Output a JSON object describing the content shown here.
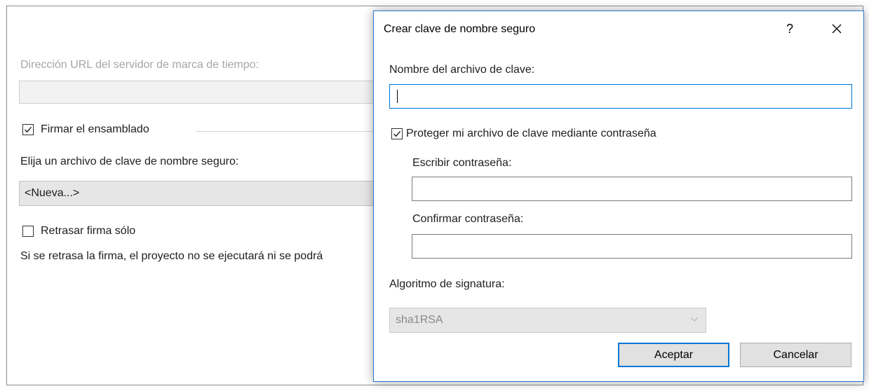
{
  "background": {
    "timestamp_url_label": "Dirección URL del servidor de marca de tiempo:",
    "timestamp_url_value": "",
    "sign_assembly_label": "Firmar el ensamblado",
    "sign_assembly_checked": true,
    "choose_key_label": "Elija un archivo de clave de nombre seguro:",
    "choose_key_value": "<Nueva...>",
    "delay_sign_label": "Retrasar firma sólo",
    "delay_sign_checked": false,
    "delay_sign_note": "Si se retrasa la firma, el proyecto no se ejecutará ni se podrá"
  },
  "dialog": {
    "title": "Crear clave de nombre seguro",
    "help_label": "?",
    "key_file_label": "Nombre del archivo de clave:",
    "key_file_value": "",
    "protect_label": "Proteger mi archivo de clave mediante contraseña",
    "protect_checked": true,
    "password_label": "Escribir contraseña:",
    "password_value": "",
    "confirm_label": "Confirmar contraseña:",
    "confirm_value": "",
    "algorithm_label": "Algoritmo de signatura:",
    "algorithm_value": "sha1RSA",
    "ok_label": "Aceptar",
    "cancel_label": "Cancelar"
  },
  "icons": {
    "close": "close-icon",
    "check": "checkmark-icon",
    "dropdown": "chevron-down-icon"
  },
  "colors": {
    "accent": "#0078d7",
    "dialog_border": "#2b79d0",
    "disabled_text": "#a6a6a6"
  }
}
